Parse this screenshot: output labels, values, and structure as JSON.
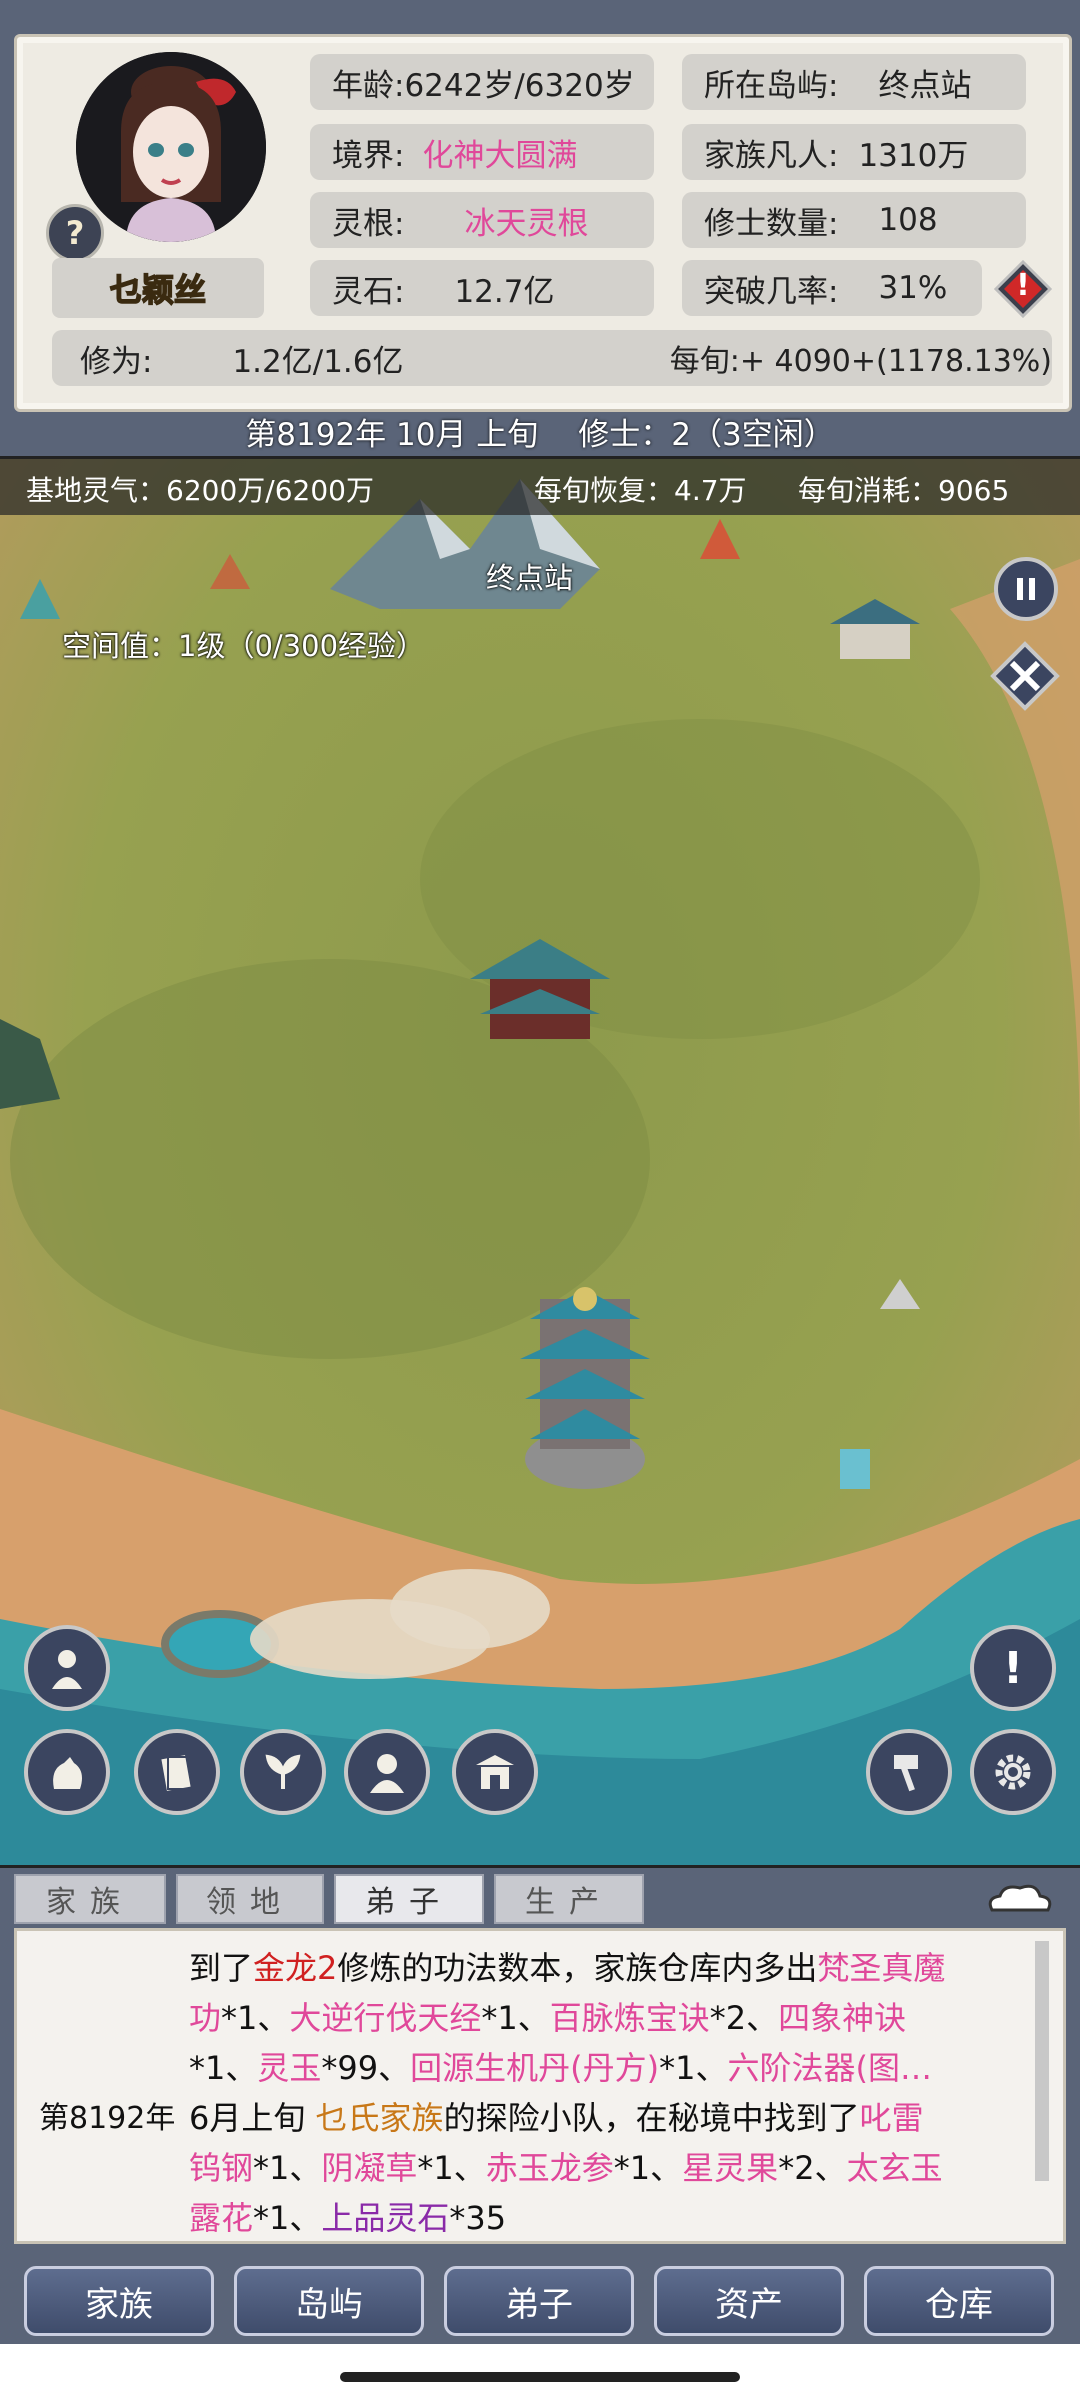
{
  "header": {
    "character_name": "乜颖丝",
    "age_label": "年龄:",
    "age_value": "6242岁/6320岁",
    "realm_label": "境界:",
    "realm_value": "化神大圆满",
    "spirit_root_label": "灵根:",
    "spirit_root_value": "冰天灵根",
    "spirit_stone_label": "灵石:",
    "spirit_stone_value": "12.7亿",
    "island_label": "所在岛屿:",
    "island_value": "终点站",
    "mortals_label": "家族凡人:",
    "mortals_value": "1310万",
    "cultivators_label": "修士数量:",
    "cultivators_value": "108",
    "breakthrough_label": "突破几率:",
    "breakthrough_value": "31%",
    "cultivation_label": "修为:",
    "cultivation_value": "1.2亿/1.6亿",
    "per_period": "每旬:+ 4090+(1178.13%)",
    "help_glyph": "?",
    "warn_glyph": "!",
    "icons": [
      "help-icon",
      "warning-icon"
    ]
  },
  "date_bar": {
    "date": "第8192年 10月 上旬",
    "cultivators_status": "修士：2（3空闲）"
  },
  "map": {
    "base_qi": "基地灵气：6200万/6200万",
    "recovery": "每旬恢复：4.7万",
    "consumption": "每旬消耗：9065",
    "location_name": "终点站",
    "space_value": "空间值：1级（0/300经验）",
    "colors": {
      "grass": "#8a9a4a",
      "sand": "#d7a06c",
      "sea": "#3aa0a8"
    },
    "right_buttons": [
      "pause-icon",
      "close-icon",
      "alert-icon",
      "hammer-icon",
      "gear-icon"
    ],
    "left_buttons": [
      "disciple-icon",
      "bag-icon",
      "card-icon",
      "herb-icon",
      "person-icon",
      "gate-icon"
    ],
    "alert_glyph": "!"
  },
  "tabs": [
    {
      "label": "家族"
    },
    {
      "label": "领地"
    },
    {
      "label": "弟子"
    },
    {
      "label": "生产"
    }
  ],
  "log": {
    "line1": [
      "到了",
      "金龙2",
      "修炼的功法数本，家族仓库内多出",
      "梵圣真魔"
    ],
    "line2": [
      "功",
      "*1、",
      "大逆行伐天经",
      "*1、",
      "百脉炼宝诀",
      "*2、",
      "四象神诀"
    ],
    "line3": [
      "*1、",
      "灵玉",
      "*99、",
      "回源生机丹(丹方)",
      "*1、",
      "六阶法器(图…"
    ],
    "date_prefix": "第8192年",
    "line4": [
      "6月上旬 ",
      "乜氏家族",
      "的探险小队，在秘境中找到了",
      "叱雷"
    ],
    "line5": [
      "钨钢",
      "*1、",
      "阴凝草",
      "*1、",
      "赤玉龙参",
      "*1、",
      "星灵果",
      "*2、",
      "太玄玉"
    ],
    "line6": [
      "露花",
      "*1、",
      "上品灵石",
      "*35"
    ]
  },
  "bottom_nav": [
    {
      "label": "家族"
    },
    {
      "label": "岛屿"
    },
    {
      "label": "弟子"
    },
    {
      "label": "资产"
    },
    {
      "label": "仓库"
    }
  ]
}
